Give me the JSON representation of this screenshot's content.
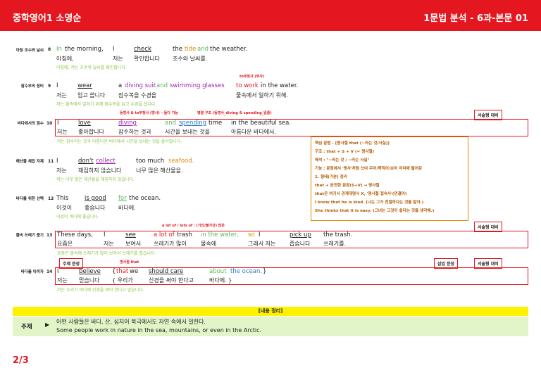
{
  "header": {
    "left": "중학영어1 소영순",
    "right": "1문법 분석 - 6과-본문 01"
  },
  "rows": {
    "r8": {
      "label": "아침 조수와 날씨",
      "num": "8",
      "en": [
        "In",
        "the morning,",
        "I",
        "check",
        "the",
        "tide",
        "and",
        "the weather."
      ],
      "ko": [
        "아침에,",
        "저는",
        "확인합니다",
        "조수와 날씨를."
      ],
      "tr": "아침에, 저는 조수와 날씨를 확인합니다."
    },
    "r9": {
      "label": "잠수부의 장비",
      "num": "9",
      "en": [
        "I",
        "wear",
        "a",
        "diving suit",
        "and",
        "swimming glasses",
        "to work",
        "in the water."
      ],
      "ko": [
        "저는",
        "입고 씁니다",
        "잠수복을 수경을",
        "물속에서 일하기 위해."
      ],
      "tr": "저는 물속에서 일하기 위해 잠수복을 입고 수경을 씁니다.",
      "ann": "to부정사 (부사)"
    },
    "r10": {
      "label": "바다에서의 잠수",
      "num": "10",
      "en": [
        "I",
        "love",
        "diving",
        "and",
        "spending",
        "time",
        "in the beautiful sea."
      ],
      "ko": [
        "저는",
        "좋아합니다",
        "잠수하는 것과",
        "시간을 보내는 것을",
        "아름다운 바다에서."
      ],
      "tr": "저는 잠수하는 것과 아름다운 바다에서 시간을 보내는 것을 좋아합니다.",
      "ann1": "동명사 & to부정사 (명사) – 둘다 가능",
      "ann2": "병렬 구조 (동명사_diving & spending_일줄)"
    },
    "r11": {
      "label": "해산물 채집 자제",
      "num": "11",
      "en": [
        "I",
        "don't",
        "collect",
        "too much",
        "seafood."
      ],
      "ko": [
        "저는",
        "채집하지 않습니다",
        "너무 많은 해산물을."
      ],
      "tr": "저는 너무 많은 해산물을 채집하지 않습니다."
    },
    "r12": {
      "label": "바다를 위한 선택",
      "num": "12",
      "en": [
        "This",
        "is good",
        "for",
        "the ocean."
      ],
      "ko": [
        "이것이",
        "좋습니다",
        "바다에."
      ],
      "tr": "이것이 바다에 좋습니다.",
      "ann": "a lot of / lots of : (가산/불가산) 많은"
    },
    "r13": {
      "label": "물속 쓰레기 줍기",
      "num": "13",
      "en": [
        "These days,",
        "I",
        "see",
        "a lot of",
        "trash",
        "in the water,",
        "so",
        "I",
        "pick up",
        "the trash."
      ],
      "ko": [
        "요즘은",
        "저는",
        "보여서",
        "쓰레기가 많이",
        "물속에",
        "그래서 저는",
        "줍습니다",
        "쓰레기를."
      ],
      "tr": "요즘은 물속에 쓰레기가 많이 보여서 쓰레기를 줍습니다.",
      "ann": "명사절 that"
    },
    "r14": {
      "label": "바다를 아끼자",
      "num": "14",
      "en": [
        "I",
        "believe",
        "{",
        "that",
        "we",
        "should care",
        "about",
        "the ocean.",
        "}"
      ],
      "ko": [
        "저는",
        "믿습니다",
        "{ 우리가",
        "신경을 써야 한다고",
        "바다에. }"
      ],
      "tr": "저는 우리가 바다에 신경을 써야 한다고 믿습니다."
    }
  },
  "tags": {
    "essay1": "서술형 대비",
    "essay2": "서술형 대비",
    "essay3": "서술형 대비",
    "topic": "주제 문장",
    "insert": "삽입 문장"
  },
  "info": [
    "핵심 문법 - [명사절 that (~라는 것/사실)]",
    "구조 : that + S + V (= 명사절)",
    "해석 : \"~라는 것 / ~라는 사실\"",
    "기능 : 문장에서 '명사'처럼 쓰여 주어/목적어/보어 자리에 들어감",
    "1. 형태(기본) 정리",
    "that + 완전한 문장(S+V) → 명사절",
    "that은 여기서 관계대명사 X, '명사절 접속사'(연결어)",
    "I know that he is kind. (나는 그가 친절하다는 것을 알아.)",
    "She thinks that it is easy. (그녀는 그것이 쉽다는 것을 생각해.)"
  ],
  "summary": {
    "head": "[내용 정리]",
    "label": "주제",
    "arrow": "▶",
    "ko": "어떤 사람들은 바다, 산, 심지어 북극에서도 자연 속에서 일한다.",
    "en": "Some people work in nature in the sea, mountains, or even in the Arctic."
  },
  "page": "2/3"
}
